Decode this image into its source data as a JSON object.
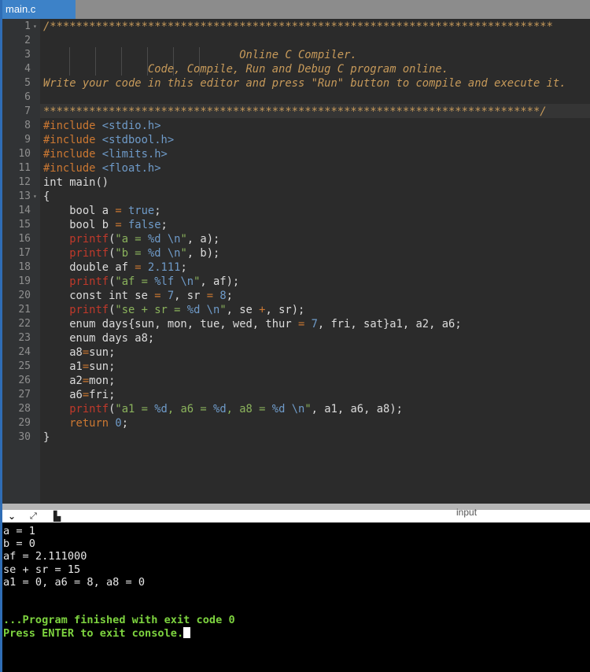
{
  "tab": {
    "label": "main.c"
  },
  "code_lines": [
    [
      [
        "c",
        "/*****************************************************************************"
      ]
    ],
    [],
    [
      [
        "c",
        "                              Online C Compiler."
      ]
    ],
    [
      [
        "c",
        "                Code, Compile, Run and Debug C program online."
      ]
    ],
    [
      [
        "c",
        "Write your code in this editor and press \"Run\" button to compile and execute it."
      ]
    ],
    [],
    [
      [
        "c",
        "****************************************************************************/"
      ]
    ],
    [
      [
        "pp",
        "#include "
      ],
      [
        "inc",
        "<stdio.h>"
      ]
    ],
    [
      [
        "pp",
        "#include "
      ],
      [
        "inc",
        "<stdbool.h>"
      ]
    ],
    [
      [
        "pp",
        "#include "
      ],
      [
        "inc",
        "<limits.h>"
      ]
    ],
    [
      [
        "pp",
        "#include "
      ],
      [
        "inc",
        "<float.h>"
      ]
    ],
    [
      [
        "",
        "int main()"
      ]
    ],
    [
      [
        "",
        "{"
      ]
    ],
    [
      [
        "",
        "    bool a "
      ],
      [
        "op",
        "="
      ],
      [
        "",
        ""
      ],
      [
        "bool",
        " true"
      ],
      [
        "",
        ";"
      ]
    ],
    [
      [
        "",
        "    bool b "
      ],
      [
        "op",
        "="
      ],
      [
        "bool",
        " false"
      ],
      [
        "",
        ";"
      ]
    ],
    [
      [
        "",
        "    "
      ],
      [
        "fn",
        "printf"
      ],
      [
        "",
        "("
      ],
      [
        "str",
        "\"a = "
      ],
      [
        "esc",
        "%d \\n"
      ],
      [
        "str",
        "\""
      ],
      [
        "",
        ", a);"
      ]
    ],
    [
      [
        "",
        "    "
      ],
      [
        "fn",
        "printf"
      ],
      [
        "",
        "("
      ],
      [
        "str",
        "\"b = "
      ],
      [
        "esc",
        "%d \\n"
      ],
      [
        "str",
        "\""
      ],
      [
        "",
        ", b);"
      ]
    ],
    [
      [
        "",
        "    double af "
      ],
      [
        "op",
        "="
      ],
      [
        "num",
        " 2.111"
      ],
      [
        "",
        ";"
      ]
    ],
    [
      [
        "",
        "    "
      ],
      [
        "fn",
        "printf"
      ],
      [
        "",
        "("
      ],
      [
        "str",
        "\"af = "
      ],
      [
        "esc",
        "%lf \\n"
      ],
      [
        "str",
        "\""
      ],
      [
        "",
        ", af);"
      ]
    ],
    [
      [
        "",
        "    const int se "
      ],
      [
        "op",
        "="
      ],
      [
        "num",
        " 7"
      ],
      [
        "",
        ", sr "
      ],
      [
        "op",
        "="
      ],
      [
        "num",
        " 8"
      ],
      [
        "",
        ";"
      ]
    ],
    [
      [
        "",
        "    "
      ],
      [
        "fn",
        "printf"
      ],
      [
        "",
        "("
      ],
      [
        "str",
        "\"se + sr = "
      ],
      [
        "esc",
        "%d \\n"
      ],
      [
        "str",
        "\""
      ],
      [
        "",
        ", se "
      ],
      [
        "op",
        "+"
      ],
      [
        "",
        ", sr);"
      ]
    ],
    [
      [
        "",
        "    enum days{sun, mon, tue, wed, thur "
      ],
      [
        "op",
        "="
      ],
      [
        "num",
        " 7"
      ],
      [
        "",
        ", fri, sat}a1, a2, a6;"
      ]
    ],
    [
      [
        "",
        "    enum days a8;"
      ]
    ],
    [
      [
        "",
        "    a8"
      ],
      [
        "op",
        "="
      ],
      [
        "",
        "sun;"
      ]
    ],
    [
      [
        "",
        "    a1"
      ],
      [
        "op",
        "="
      ],
      [
        "",
        "sun;"
      ]
    ],
    [
      [
        "",
        "    a2"
      ],
      [
        "op",
        "="
      ],
      [
        "",
        "mon;"
      ]
    ],
    [
      [
        "",
        "    a6"
      ],
      [
        "op",
        "="
      ],
      [
        "",
        "fri;"
      ]
    ],
    [
      [
        "",
        "    "
      ],
      [
        "fn",
        "printf"
      ],
      [
        "",
        "("
      ],
      [
        "str",
        "\"a1 = "
      ],
      [
        "esc",
        "%d"
      ],
      [
        "str",
        ", a6 = "
      ],
      [
        "esc",
        "%d"
      ],
      [
        "str",
        ", a8 = "
      ],
      [
        "esc",
        "%d \\n"
      ],
      [
        "str",
        "\""
      ],
      [
        "",
        ", a1, a6, a8);"
      ]
    ],
    [
      [
        "kw",
        "    return"
      ],
      [
        "num",
        " 0"
      ],
      [
        "",
        ";"
      ]
    ],
    [
      [
        "",
        "}"
      ]
    ]
  ],
  "console": {
    "input_label": "input",
    "output": [
      "a = 1",
      "b = 0",
      "af = 2.111000",
      "se + sr = 15",
      "a1 = 0, a6 = 8, a8 = 0",
      "",
      ""
    ],
    "finished": "...Program finished with exit code 0",
    "prompt": "Press ENTER to exit console."
  },
  "icons": {
    "collapse": "chevron-down-icon",
    "expand": "expand-icon",
    "clear": "clear-console-icon"
  }
}
